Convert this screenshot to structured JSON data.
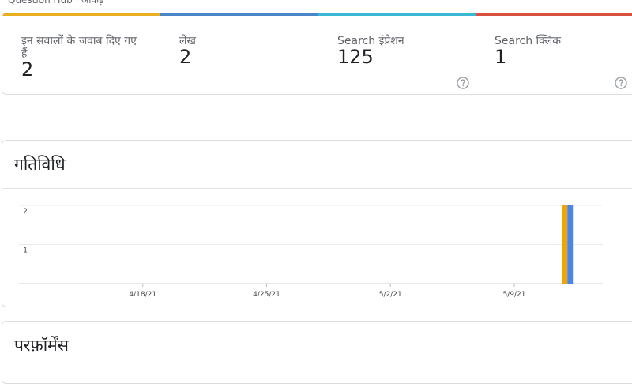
{
  "top_header": {
    "text": "Question Hub · आँकड़े"
  },
  "stats": {
    "colors": [
      "#e8b020",
      "#4a86c8",
      "#3ab8d4",
      "#d9503f"
    ],
    "items": [
      {
        "label": "इन सवालों के जवाब दिए गए हैं",
        "value": "2"
      },
      {
        "label": "लेख",
        "value": "2"
      },
      {
        "label": "Search इंप्रेशन",
        "value": "125"
      },
      {
        "label": "Search क्लिक",
        "value": "1"
      }
    ],
    "help_icon": "help-circle-icon"
  },
  "activity": {
    "title": "गतिविधि"
  },
  "performance": {
    "title": "परफ़ॉर्मेंस"
  },
  "chart_data": {
    "type": "bar",
    "title": "",
    "xlabel": "",
    "ylabel": "",
    "ylim": [
      0,
      2
    ],
    "y_ticks": [
      "1",
      "2"
    ],
    "x_ticks": [
      "4/18/21",
      "4/25/21",
      "5/2/21",
      "5/9/21"
    ],
    "x_range": [
      "4/11/21",
      "5/14/21"
    ],
    "grid": true,
    "legend": "none",
    "series": [
      {
        "color": "#f2a500",
        "x": [
          "5/12/21"
        ],
        "values": [
          2
        ]
      },
      {
        "color": "#4a86e8",
        "x": [
          "5/12/21"
        ],
        "values": [
          2
        ]
      }
    ]
  }
}
